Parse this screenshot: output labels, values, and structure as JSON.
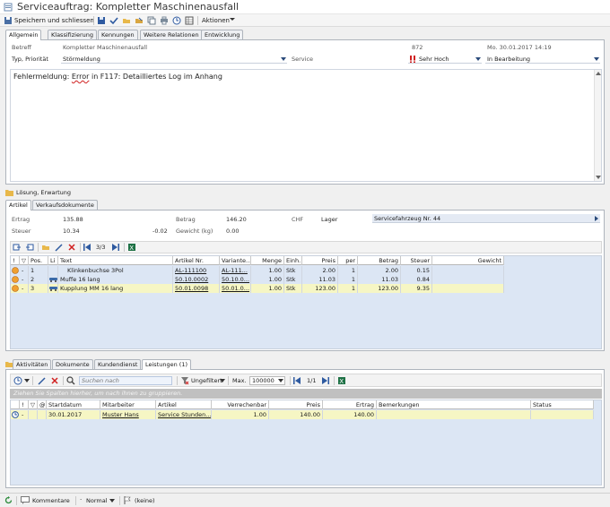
{
  "window": {
    "title": "Serviceauftrag: Kompletter Maschinenausfall"
  },
  "toolbar": {
    "save_close": "Speichern und schliessen",
    "actions": "Aktionen",
    "icons": [
      "save-icon",
      "check-icon",
      "folder-open-icon",
      "folder-export-icon",
      "copy-icon",
      "print-icon",
      "clock-icon",
      "grid-icon"
    ]
  },
  "main_tabs": [
    "Allgemein",
    "Klassifizierung",
    "Kennungen",
    "Weitere Relationen",
    "Entwicklung"
  ],
  "general": {
    "betreff_label": "Betreff",
    "betreff_value": "Kompletter Maschinenausfall",
    "number": "872",
    "date": "Mo. 30.01.2017 14:19",
    "typ_label": "Typ, Priorität",
    "typ_value": "Störmeldung",
    "service_label": "Service",
    "priority_value": "Sehr Hoch",
    "status_value": "In Bearbeitung",
    "description_prefix": "Fehlermeldung: ",
    "description_error": "Error",
    "description_suffix": " in F117: Detailliertes Log im Anhang"
  },
  "solution_section": "Lösung, Erwartung",
  "article_tabs": [
    "Artikel",
    "Verkaufsdokumente"
  ],
  "summary": {
    "ertrag_label": "Ertrag",
    "ertrag_value": "135.88",
    "betrag_label": "Betrag",
    "betrag_value": "146.20",
    "currency": "CHF",
    "lager_label": "Lager",
    "lager_value": "Servicefahrzeug Nr. 44",
    "steuer_label": "Steuer",
    "steuer_value": "10.34",
    "steuer_diff": "-0.02",
    "gewicht_label": "Gewicht (kg)",
    "gewicht_value": "0.00"
  },
  "article_nav": "3/3",
  "article_grid": {
    "headers": [
      "Pos.",
      "Li",
      "Text",
      "Artikel Nr.",
      "Variante...",
      "Menge",
      "Einh.",
      "Preis",
      "per",
      "Betrag",
      "Steuer",
      "Gewicht"
    ],
    "rows": [
      {
        "pos": "1",
        "text": "Klinkenbuchse 3Pol",
        "art": "AL-111100",
        "var": "AL-111...",
        "menge": "1.00",
        "einh": "Stk",
        "preis": "2.00",
        "per": "1",
        "betrag": "2.00",
        "steuer": "0.15",
        "gewicht": ""
      },
      {
        "pos": "2",
        "text": "Muffe 16 lang",
        "art": "50.10.0002",
        "var": "50.10.0...",
        "menge": "1.00",
        "einh": "Stk",
        "preis": "11.03",
        "per": "1",
        "betrag": "11.03",
        "steuer": "0.84",
        "gewicht": ""
      },
      {
        "pos": "3",
        "text": "Kupplung MM 16 lang",
        "art": "50.01.0098",
        "var": "50.01.0...",
        "menge": "1.00",
        "einh": "Stk",
        "preis": "123.00",
        "per": "1",
        "betrag": "123.00",
        "steuer": "9.35",
        "gewicht": ""
      }
    ]
  },
  "bottom_tabs": [
    "Aktivitäten",
    "Dokumente",
    "Kundendienst",
    "Leistungen (1)"
  ],
  "leistungen": {
    "search_placeholder": "Suchen nach",
    "filter": "Ungefiltert",
    "max_label": "Max.",
    "max_value": "100000",
    "nav": "1/1",
    "group_hint": "Ziehen Sie Spalten hierher, um nach ihnen zu gruppieren.",
    "headers": [
      "Startdatum",
      "Mitarbeiter",
      "Artikel",
      "Verrechenbar",
      "Preis",
      "Ertrag",
      "Bemerkungen",
      "Status"
    ],
    "rows": [
      {
        "start": "30.01.2017",
        "mitarbeiter": "Muster Hans",
        "artikel": "Service Stunden...",
        "verrechenbar": "1.00",
        "preis": "140.00",
        "ertrag": "140.00",
        "bemerkungen": "",
        "status": ""
      }
    ]
  },
  "statusbar": {
    "comments": "Kommentare",
    "priority": "Normal",
    "flag": "(keine)"
  }
}
